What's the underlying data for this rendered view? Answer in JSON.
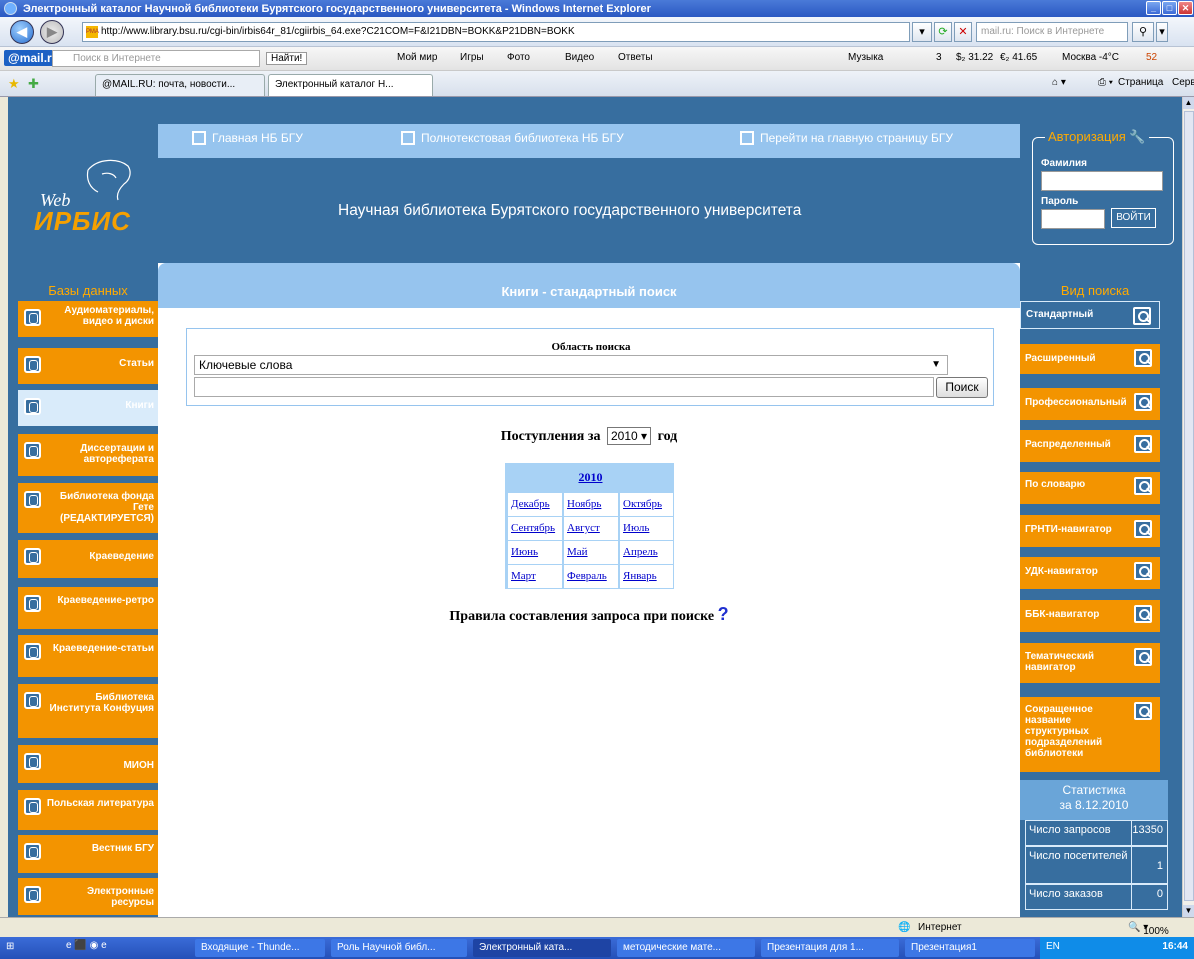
{
  "window": {
    "title": "Электронный каталог Научной библиотеки Бурятского государственного университета - Windows Internet Explorer"
  },
  "address": {
    "url": "http://www.library.bsu.ru/cgi-bin/irbis64r_81/cgiirbis_64.exe?C21COM=F&I21DBN=BOKK&P21DBN=BOKK",
    "search_placeholder": "mail.ru: Поиск в Интернете"
  },
  "mailbar": {
    "brand": "@mail.ru",
    "search_placeholder": "Поиск в Интернете",
    "find": "Найти!",
    "items": [
      "Мой мир",
      "Игры",
      "Фото",
      "Видео",
      "Ответы"
    ],
    "music": "Музыка",
    "mail_count": "3",
    "usd": "$₂ 31.22",
    "eur": "€₂ 41.65",
    "weather": "Москва -4°C",
    "count52": "52"
  },
  "tabs": [
    {
      "label": "@MAIL.RU: почта, новости..."
    },
    {
      "label": "Электронный каталог Н..."
    }
  ],
  "tabtools": {
    "page": "Страница",
    "service": "Сервис"
  },
  "topnav": [
    "Главная НБ БГУ",
    "Полнотекстовая библиотека НБ БГУ",
    "Перейти на главную страницу БГУ"
  ],
  "header": {
    "title": "Научная библиотека Бурятского государственного университета",
    "logo_web": "Web",
    "logo_irbis": "ИРБИС"
  },
  "auth": {
    "legend": "Авторизация",
    "surname": "Фамилия",
    "password": "Пароль",
    "login": "ВОЙТИ"
  },
  "databases": {
    "heading": "Базы данных",
    "items": [
      "Аудиоматериалы, видео и диски",
      "Статьи",
      "Книги",
      "Диссертации и автореферата",
      "Библиотека фонда Гете (РЕДАКТИРУЕТСЯ)",
      "Краеведение",
      "Краеведение-ретро",
      "Краеведение-статьи",
      "Библиотека Института Конфуция",
      "МИОН",
      "Польская литература",
      "Вестник БГУ",
      "Электронные ресурсы"
    ]
  },
  "content": {
    "heading": "Книги - стандартный поиск",
    "area_title": "Область поиска",
    "area_value": "Ключевые слова",
    "search_btn": "Поиск",
    "arrivals_pre": "Поступления за",
    "arrivals_year": "2010",
    "arrivals_post": "год",
    "rules": "Правила составления запроса при поиске",
    "rules_q": "?"
  },
  "months": {
    "year": "2010",
    "items": [
      "Декабрь",
      "Ноябрь",
      "Октябрь",
      "Сентябрь",
      "Август",
      "Июль",
      "Июнь",
      "Май",
      "Апрель",
      "Март",
      "Февраль",
      "Январь"
    ]
  },
  "search_types": {
    "heading": "Вид поиска",
    "items": [
      "Стандартный",
      "Расширенный",
      "Профессиональный",
      "Распределенный",
      "По словарю",
      "ГРНТИ-навигатор",
      "УДК-навигатор",
      "ББК-навигатор",
      "Тематический навигатор",
      "Сокращенное название структурных подразделений библиотеки"
    ]
  },
  "stats": {
    "heading": "Статистика",
    "date": "за 8.12.2010",
    "rows": [
      {
        "k": "Число запросов",
        "v": "13350"
      },
      {
        "k": "Число посетителей",
        "v": "1"
      },
      {
        "k": "Число заказов",
        "v": "0"
      }
    ]
  },
  "status": {
    "zone": "Интернет",
    "zoom": "100%"
  },
  "taskbar": {
    "items": [
      "Входящие - Thunde...",
      "Роль Научной библ...",
      "Электронный ката...",
      "методические мате...",
      "Презентация для 1...",
      "Презентация1"
    ],
    "lang": "EN",
    "time": "16:44"
  }
}
